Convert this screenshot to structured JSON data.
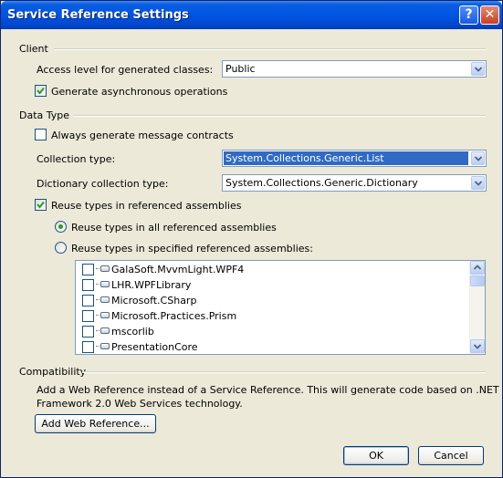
{
  "window": {
    "title": "Service Reference Settings",
    "help_glyph": "?",
    "close_glyph": "✕"
  },
  "client": {
    "heading": "Client",
    "access_level_label": "Access level for generated classes:",
    "access_level_value": "Public",
    "generate_async_label": "Generate asynchronous operations",
    "generate_async_checked": true
  },
  "data_type": {
    "heading": "Data Type",
    "always_generate_label": "Always generate message contracts",
    "always_generate_checked": false,
    "collection_type_label": "Collection type:",
    "collection_type_value": "System.Collections.Generic.List",
    "dictionary_type_label": "Dictionary collection type:",
    "dictionary_type_value": "System.Collections.Generic.Dictionary",
    "reuse_types_label": "Reuse types in referenced assemblies",
    "reuse_types_checked": true,
    "reuse_all_label": "Reuse types in all referenced assemblies",
    "reuse_specified_label": "Reuse types in specified referenced assemblies:",
    "selected_reuse_option": "all",
    "assemblies": [
      {
        "name": "GalaSoft.MvvmLight.WPF4",
        "checked": false
      },
      {
        "name": "LHR.WPFLibrary",
        "checked": false
      },
      {
        "name": "Microsoft.CSharp",
        "checked": false
      },
      {
        "name": "Microsoft.Practices.Prism",
        "checked": false
      },
      {
        "name": "mscorlib",
        "checked": false
      },
      {
        "name": "PresentationCore",
        "checked": false
      }
    ]
  },
  "compatibility": {
    "heading": "Compatibility",
    "description_line1": "Add a Web Reference instead of a Service Reference. This will generate code based on .NET",
    "description_line2": "Framework 2.0 Web Services technology.",
    "add_web_reference_label": "Add Web Reference..."
  },
  "footer": {
    "ok_label": "OK",
    "cancel_label": "Cancel"
  }
}
